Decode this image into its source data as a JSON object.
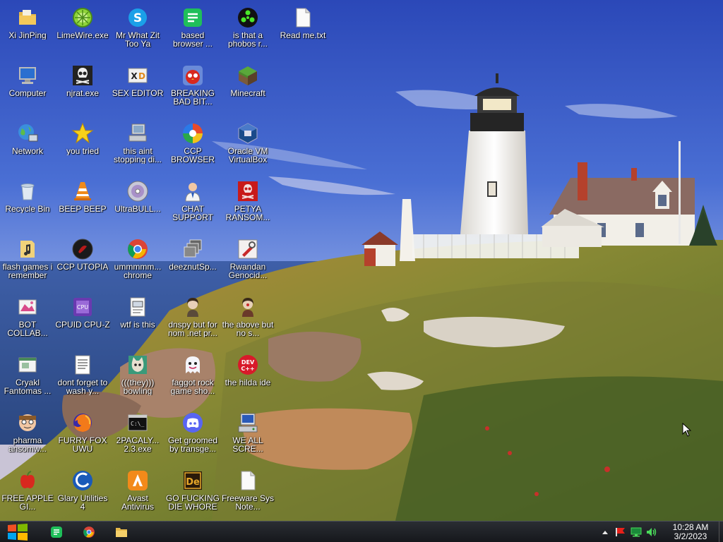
{
  "desktop": {
    "icons": [
      {
        "id": "xi-jinping",
        "label": "Xi JinPing",
        "icon": "folder-icon"
      },
      {
        "id": "limewire",
        "label": "LimeWire.exe",
        "icon": "limewire-icon"
      },
      {
        "id": "mr-what-zit",
        "label": "Mr What Zit Too Ya",
        "icon": "skype-icon"
      },
      {
        "id": "based-browser",
        "label": "based browser ...",
        "icon": "green-doc-icon"
      },
      {
        "id": "phobos",
        "label": "is that a phobos r...",
        "icon": "green-dots-icon"
      },
      {
        "id": "read-me",
        "label": "Read me.txt",
        "icon": "text-file-icon"
      },
      {
        "id": "computer",
        "label": "Computer",
        "icon": "computer-icon"
      },
      {
        "id": "njrat",
        "label": "njrat.exe",
        "icon": "skull-icon"
      },
      {
        "id": "sex-editor",
        "label": "SEX EDITOR",
        "icon": "hex-editor-icon"
      },
      {
        "id": "breaking-bad",
        "label": "BREAKING BAD BIT...",
        "icon": "angry-bird-icon"
      },
      {
        "id": "minecraft",
        "label": "Minecraft",
        "icon": "grass-block-icon"
      },
      {
        "id": "network",
        "label": "Network",
        "icon": "globe-icon"
      },
      {
        "id": "you-tried",
        "label": "you tried",
        "icon": "star-icon"
      },
      {
        "id": "this-aint-stopping",
        "label": "this aint stopping di...",
        "icon": "pc-setup-icon"
      },
      {
        "id": "ccp-browser",
        "label": "CCP BROWSER",
        "icon": "pinwheel-icon"
      },
      {
        "id": "oracle-vm",
        "label": "Oracle VM VirtualBox",
        "icon": "virtualbox-icon"
      },
      {
        "id": "recycle-bin",
        "label": "Recycle Bin",
        "icon": "recycle-bin-icon"
      },
      {
        "id": "beep-beep",
        "label": "BEEP BEEP",
        "icon": "traffic-cone-icon"
      },
      {
        "id": "ultrabull",
        "label": "UltraBULL...",
        "icon": "disc-icon"
      },
      {
        "id": "chat-support",
        "label": "CHAT SUPPORT",
        "icon": "support-person-icon"
      },
      {
        "id": "petya",
        "label": "PETYA RANSOM...",
        "icon": "red-skull-icon"
      },
      {
        "id": "flash-games",
        "label": "flash games i remember",
        "icon": "music-folder-icon"
      },
      {
        "id": "ccp-utopia",
        "label": "CCP UTOPIA",
        "icon": "dark-circle-icon"
      },
      {
        "id": "ummmmm-chrome",
        "label": "ummmmm... chrome",
        "icon": "chrome-icon"
      },
      {
        "id": "deeznut",
        "label": "deeznutSp...",
        "icon": "stacked-windows-icon"
      },
      {
        "id": "rwandan",
        "label": "Rwandan Genocid...",
        "icon": "tools-icon"
      },
      {
        "id": "bot-collab",
        "label": "BOT COLLAB...",
        "icon": "pink-image-icon"
      },
      {
        "id": "cpuid",
        "label": "CPUID CPU-Z",
        "icon": "cpuz-icon"
      },
      {
        "id": "wtf-is-this",
        "label": "wtf is this",
        "icon": "doc-window-icon"
      },
      {
        "id": "dnspy",
        "label": "dnspy but for nom .net pr...",
        "icon": "portrait-icon"
      },
      {
        "id": "the-above",
        "label": "the above but no s...",
        "icon": "portrait-icon"
      },
      {
        "id": "cryakl",
        "label": "Cryakl Fantomas ...",
        "icon": "window-icon"
      },
      {
        "id": "dont-forget",
        "label": "dont forget to wash y...",
        "icon": "notepad-icon"
      },
      {
        "id": "they-bowling",
        "label": "(((they))) bowling",
        "icon": "cat-face-icon"
      },
      {
        "id": "faggot-rock",
        "label": "faggot rock game sho...",
        "icon": "ghost-icon"
      },
      {
        "id": "the-hilda-ide",
        "label": "the hilda ide",
        "icon": "devcpp-icon"
      },
      {
        "id": "pharma",
        "label": "pharma ansomw...",
        "icon": "cartoon-face-icon"
      },
      {
        "id": "furry-fox",
        "label": "FURRY FOX UWU",
        "icon": "firefox-icon"
      },
      {
        "id": "2pacaly",
        "label": "2PACALY... 2.3.exe",
        "icon": "terminal-icon"
      },
      {
        "id": "get-groomed",
        "label": "Get groomed by transge...",
        "icon": "discord-icon"
      },
      {
        "id": "we-all-scre",
        "label": "WE ALL SCRE...",
        "icon": "server-icon"
      },
      {
        "id": "free-apple",
        "label": "FREE APPLE GI...",
        "icon": "apple-icon"
      },
      {
        "id": "glary",
        "label": "Glary Utilities 4",
        "icon": "glary-icon"
      },
      {
        "id": "avast",
        "label": "Avast Antivirus",
        "icon": "avast-icon"
      },
      {
        "id": "go-fucking",
        "label": "GO FUCKING DIE WHORE",
        "icon": "de-icon"
      },
      {
        "id": "freeware",
        "label": "Freeware Sys Note...",
        "icon": "blank-file-icon"
      }
    ]
  },
  "taskbar": {
    "pinned": [
      {
        "id": "green-app",
        "icon": "green-doc-icon"
      },
      {
        "id": "chrome",
        "icon": "chrome-icon"
      },
      {
        "id": "explorer",
        "icon": "folder-icon"
      }
    ],
    "clock": {
      "time": "10:28 AM",
      "date": "3/2/2023"
    }
  },
  "colors": {
    "sky": "#4a6fd0",
    "taskbar": "#1e2126",
    "label_text": "#ffffff"
  }
}
